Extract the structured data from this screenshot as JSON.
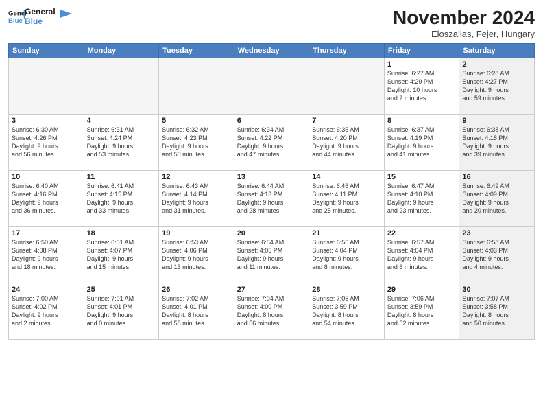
{
  "header": {
    "logo_line1": "General",
    "logo_line2": "Blue",
    "month": "November 2024",
    "location": "Eloszallas, Fejer, Hungary"
  },
  "weekdays": [
    "Sunday",
    "Monday",
    "Tuesday",
    "Wednesday",
    "Thursday",
    "Friday",
    "Saturday"
  ],
  "weeks": [
    [
      {
        "day": "",
        "info": "",
        "empty": true
      },
      {
        "day": "",
        "info": "",
        "empty": true
      },
      {
        "day": "",
        "info": "",
        "empty": true
      },
      {
        "day": "",
        "info": "",
        "empty": true
      },
      {
        "day": "",
        "info": "",
        "empty": true
      },
      {
        "day": "1",
        "info": "Sunrise: 6:27 AM\nSunset: 4:29 PM\nDaylight: 10 hours\nand 2 minutes.",
        "shaded": false
      },
      {
        "day": "2",
        "info": "Sunrise: 6:28 AM\nSunset: 4:27 PM\nDaylight: 9 hours\nand 59 minutes.",
        "shaded": true
      }
    ],
    [
      {
        "day": "3",
        "info": "Sunrise: 6:30 AM\nSunset: 4:26 PM\nDaylight: 9 hours\nand 56 minutes.",
        "shaded": false
      },
      {
        "day": "4",
        "info": "Sunrise: 6:31 AM\nSunset: 4:24 PM\nDaylight: 9 hours\nand 53 minutes.",
        "shaded": false
      },
      {
        "day": "5",
        "info": "Sunrise: 6:32 AM\nSunset: 4:23 PM\nDaylight: 9 hours\nand 50 minutes.",
        "shaded": false
      },
      {
        "day": "6",
        "info": "Sunrise: 6:34 AM\nSunset: 4:22 PM\nDaylight: 9 hours\nand 47 minutes.",
        "shaded": false
      },
      {
        "day": "7",
        "info": "Sunrise: 6:35 AM\nSunset: 4:20 PM\nDaylight: 9 hours\nand 44 minutes.",
        "shaded": false
      },
      {
        "day": "8",
        "info": "Sunrise: 6:37 AM\nSunset: 4:19 PM\nDaylight: 9 hours\nand 41 minutes.",
        "shaded": false
      },
      {
        "day": "9",
        "info": "Sunrise: 6:38 AM\nSunset: 4:18 PM\nDaylight: 9 hours\nand 39 minutes.",
        "shaded": true
      }
    ],
    [
      {
        "day": "10",
        "info": "Sunrise: 6:40 AM\nSunset: 4:16 PM\nDaylight: 9 hours\nand 36 minutes.",
        "shaded": false
      },
      {
        "day": "11",
        "info": "Sunrise: 6:41 AM\nSunset: 4:15 PM\nDaylight: 9 hours\nand 33 minutes.",
        "shaded": false
      },
      {
        "day": "12",
        "info": "Sunrise: 6:43 AM\nSunset: 4:14 PM\nDaylight: 9 hours\nand 31 minutes.",
        "shaded": false
      },
      {
        "day": "13",
        "info": "Sunrise: 6:44 AM\nSunset: 4:13 PM\nDaylight: 9 hours\nand 28 minutes.",
        "shaded": false
      },
      {
        "day": "14",
        "info": "Sunrise: 6:46 AM\nSunset: 4:11 PM\nDaylight: 9 hours\nand 25 minutes.",
        "shaded": false
      },
      {
        "day": "15",
        "info": "Sunrise: 6:47 AM\nSunset: 4:10 PM\nDaylight: 9 hours\nand 23 minutes.",
        "shaded": false
      },
      {
        "day": "16",
        "info": "Sunrise: 6:49 AM\nSunset: 4:09 PM\nDaylight: 9 hours\nand 20 minutes.",
        "shaded": true
      }
    ],
    [
      {
        "day": "17",
        "info": "Sunrise: 6:50 AM\nSunset: 4:08 PM\nDaylight: 9 hours\nand 18 minutes.",
        "shaded": false
      },
      {
        "day": "18",
        "info": "Sunrise: 6:51 AM\nSunset: 4:07 PM\nDaylight: 9 hours\nand 15 minutes.",
        "shaded": false
      },
      {
        "day": "19",
        "info": "Sunrise: 6:53 AM\nSunset: 4:06 PM\nDaylight: 9 hours\nand 13 minutes.",
        "shaded": false
      },
      {
        "day": "20",
        "info": "Sunrise: 6:54 AM\nSunset: 4:05 PM\nDaylight: 9 hours\nand 11 minutes.",
        "shaded": false
      },
      {
        "day": "21",
        "info": "Sunrise: 6:56 AM\nSunset: 4:04 PM\nDaylight: 9 hours\nand 8 minutes.",
        "shaded": false
      },
      {
        "day": "22",
        "info": "Sunrise: 6:57 AM\nSunset: 4:04 PM\nDaylight: 9 hours\nand 6 minutes.",
        "shaded": false
      },
      {
        "day": "23",
        "info": "Sunrise: 6:58 AM\nSunset: 4:03 PM\nDaylight: 9 hours\nand 4 minutes.",
        "shaded": true
      }
    ],
    [
      {
        "day": "24",
        "info": "Sunrise: 7:00 AM\nSunset: 4:02 PM\nDaylight: 9 hours\nand 2 minutes.",
        "shaded": false
      },
      {
        "day": "25",
        "info": "Sunrise: 7:01 AM\nSunset: 4:01 PM\nDaylight: 9 hours\nand 0 minutes.",
        "shaded": false
      },
      {
        "day": "26",
        "info": "Sunrise: 7:02 AM\nSunset: 4:01 PM\nDaylight: 8 hours\nand 58 minutes.",
        "shaded": false
      },
      {
        "day": "27",
        "info": "Sunrise: 7:04 AM\nSunset: 4:00 PM\nDaylight: 8 hours\nand 56 minutes.",
        "shaded": false
      },
      {
        "day": "28",
        "info": "Sunrise: 7:05 AM\nSunset: 3:59 PM\nDaylight: 8 hours\nand 54 minutes.",
        "shaded": false
      },
      {
        "day": "29",
        "info": "Sunrise: 7:06 AM\nSunset: 3:59 PM\nDaylight: 8 hours\nand 52 minutes.",
        "shaded": false
      },
      {
        "day": "30",
        "info": "Sunrise: 7:07 AM\nSunset: 3:58 PM\nDaylight: 8 hours\nand 50 minutes.",
        "shaded": true
      }
    ]
  ]
}
